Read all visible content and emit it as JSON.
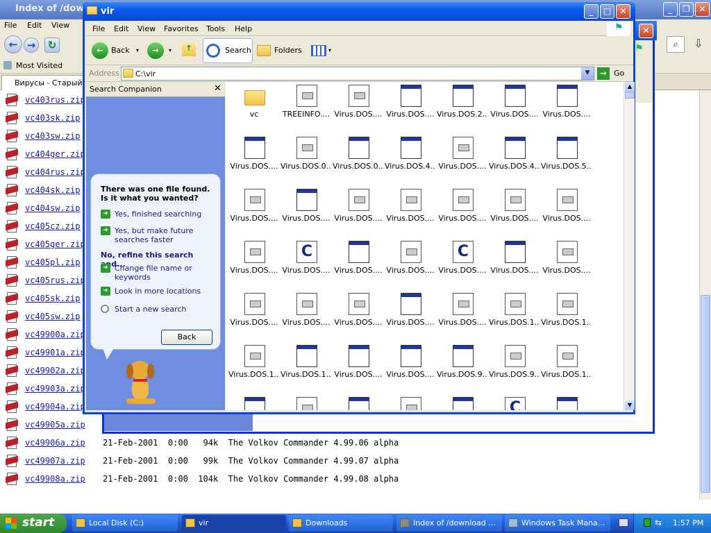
{
  "firefox": {
    "title": "Index of /download",
    "menu": [
      "File",
      "Edit",
      "View"
    ],
    "bookmarks": [
      "Most Visited"
    ],
    "tab": "Вирусы - Старый D",
    "rows": [
      {
        "name": "vc403rus.zip",
        "meta": ""
      },
      {
        "name": "vc403sk.zip",
        "meta": ""
      },
      {
        "name": "vc403sw.zip",
        "meta": ""
      },
      {
        "name": "vc404ger.zip",
        "meta": ""
      },
      {
        "name": "vc404rus.zip",
        "meta": ""
      },
      {
        "name": "vc404sk.zip",
        "meta": ""
      },
      {
        "name": "vc404sw.zip",
        "meta": ""
      },
      {
        "name": "vc405cz.zip",
        "meta": ""
      },
      {
        "name": "vc405ger.zip",
        "meta": ""
      },
      {
        "name": "vc405pl.zip",
        "meta": ""
      },
      {
        "name": "vc405rus.zip",
        "meta": ""
      },
      {
        "name": "vc405sk.zip",
        "meta": ""
      },
      {
        "name": "vc405sw.zip",
        "meta": ""
      },
      {
        "name": "vc49900a.zip",
        "meta": ""
      },
      {
        "name": "vc49901a.zip",
        "meta": ""
      },
      {
        "name": "vc49902a.zip",
        "meta": ""
      },
      {
        "name": "vc49903a.zip",
        "meta": ""
      },
      {
        "name": "vc49904a.zip",
        "meta": ""
      },
      {
        "name": "vc49905a.zip",
        "meta": ""
      },
      {
        "name": "vc49906a.zip",
        "meta": "21-Feb-2001  0:00   94k  The Volkov Commander 4.99.06 alpha"
      },
      {
        "name": "vc49907a.zip",
        "meta": "21-Feb-2001  0:00   99k  The Volkov Commander 4.99.07 alpha"
      },
      {
        "name": "vc49908a.zip",
        "meta": "21-Feb-2001  0:00  104k  The Volkov Commander 4.99.08 alpha"
      }
    ]
  },
  "vir": {
    "title": "vir",
    "menu": [
      "File",
      "Edit",
      "View",
      "Favorites",
      "Tools",
      "Help"
    ],
    "toolbar": {
      "back": "Back",
      "search": "Search",
      "folders": "Folders"
    },
    "address_label": "Address",
    "address_value": "C:\\vir",
    "go_label": "Go",
    "behind_go": "Go",
    "pane": {
      "title": "Search Companion",
      "found": "There was one file found.  Is it what you wanted?",
      "opt1": "Yes, finished searching",
      "opt2": "Yes, but make future searches faster",
      "refine": "No, refine this search and...",
      "opt3": "Change file name or keywords",
      "opt4": "Look in more locations",
      "opt5": "Start a new search",
      "back": "Back"
    },
    "files": [
      {
        "name": "vc",
        "icon": "folder"
      },
      {
        "name": "TREEINFO....",
        "icon": "doc"
      },
      {
        "name": "Virus.DOS....",
        "icon": "doc"
      },
      {
        "name": "Virus.DOS....",
        "icon": "win"
      },
      {
        "name": "Virus.DOS.2...",
        "icon": "win"
      },
      {
        "name": "Virus.DOS....",
        "icon": "win"
      },
      {
        "name": "Virus.DOS....",
        "icon": "win"
      },
      {
        "name": "Virus.DOS....",
        "icon": "win"
      },
      {
        "name": "Virus.DOS.0...",
        "icon": "doc"
      },
      {
        "name": "Virus.DOS.0...",
        "icon": "win"
      },
      {
        "name": "Virus.DOS.4...",
        "icon": "win"
      },
      {
        "name": "Virus.DOS....",
        "icon": "doc"
      },
      {
        "name": "Virus.DOS.4...",
        "icon": "win"
      },
      {
        "name": "Virus.DOS.5...",
        "icon": "win"
      },
      {
        "name": "Virus.DOS....",
        "icon": "doc"
      },
      {
        "name": "Virus.DOS....",
        "icon": "win"
      },
      {
        "name": "Virus.DOS....",
        "icon": "doc"
      },
      {
        "name": "Virus.DOS....",
        "icon": "doc"
      },
      {
        "name": "Virus.DOS....",
        "icon": "doc"
      },
      {
        "name": "Virus.DOS....",
        "icon": "doc"
      },
      {
        "name": "Virus.DOS....",
        "icon": "doc"
      },
      {
        "name": "Virus.DOS....",
        "icon": "doc"
      },
      {
        "name": "Virus.DOS....",
        "icon": "c"
      },
      {
        "name": "Virus.DOS....",
        "icon": "win"
      },
      {
        "name": "Virus.DOS....",
        "icon": "doc"
      },
      {
        "name": "Virus.DOS....",
        "icon": "c"
      },
      {
        "name": "Virus.DOS....",
        "icon": "win"
      },
      {
        "name": "Virus.DOS....",
        "icon": "doc"
      },
      {
        "name": "Virus.DOS....",
        "icon": "doc"
      },
      {
        "name": "Virus.DOS....",
        "icon": "doc"
      },
      {
        "name": "Virus.DOS....",
        "icon": "doc"
      },
      {
        "name": "Virus.DOS....",
        "icon": "win"
      },
      {
        "name": "Virus.DOS....",
        "icon": "doc"
      },
      {
        "name": "Virus.DOS.1...",
        "icon": "doc"
      },
      {
        "name": "Virus.DOS.1...",
        "icon": "doc"
      },
      {
        "name": "Virus.DOS.1...",
        "icon": "doc"
      },
      {
        "name": "Virus.DOS.1...",
        "icon": "win"
      },
      {
        "name": "Virus.DOS....",
        "icon": "win"
      },
      {
        "name": "Virus.DOS....",
        "icon": "win"
      },
      {
        "name": "Virus.DOS.9...",
        "icon": "win"
      },
      {
        "name": "Virus.DOS.9...",
        "icon": "doc"
      },
      {
        "name": "Virus.DOS.1...",
        "icon": "doc"
      }
    ]
  },
  "taskbar": {
    "start": "start",
    "tasks": [
      {
        "label": "Local Disk (C:)",
        "active": false
      },
      {
        "label": "vir",
        "active": true
      },
      {
        "label": "Downloads",
        "active": false
      },
      {
        "label": "Index of /download ...",
        "active": false
      },
      {
        "label": "Windows Task Mana...",
        "active": false
      }
    ],
    "clock": "1:57 PM"
  }
}
